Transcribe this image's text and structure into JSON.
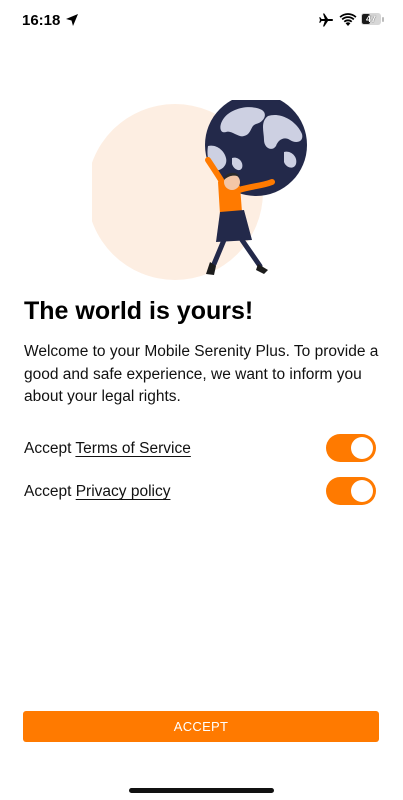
{
  "status_bar": {
    "time": "16:18",
    "battery_level": "47",
    "icons": [
      "location-arrow-icon",
      "airplane-icon",
      "wifi-icon",
      "battery-icon"
    ]
  },
  "onboarding": {
    "illustration": "woman-holding-globe-illustration",
    "headline": "The world is yours!",
    "intro": "Welcome to your Mobile Serenity Plus. To provide a good and safe experience, we want to inform you about your legal rights.",
    "consents": [
      {
        "prefix": "Accept",
        "link_text": "Terms of Service",
        "enabled": true
      },
      {
        "prefix": "Accept",
        "link_text": "Privacy policy",
        "enabled": true
      }
    ],
    "accept_label": "ACCEPT"
  },
  "colors": {
    "accent": "#ff7a00",
    "circle_bg": "#fdeee2",
    "globe": "#23294a",
    "continents": "#cdd0e2"
  }
}
